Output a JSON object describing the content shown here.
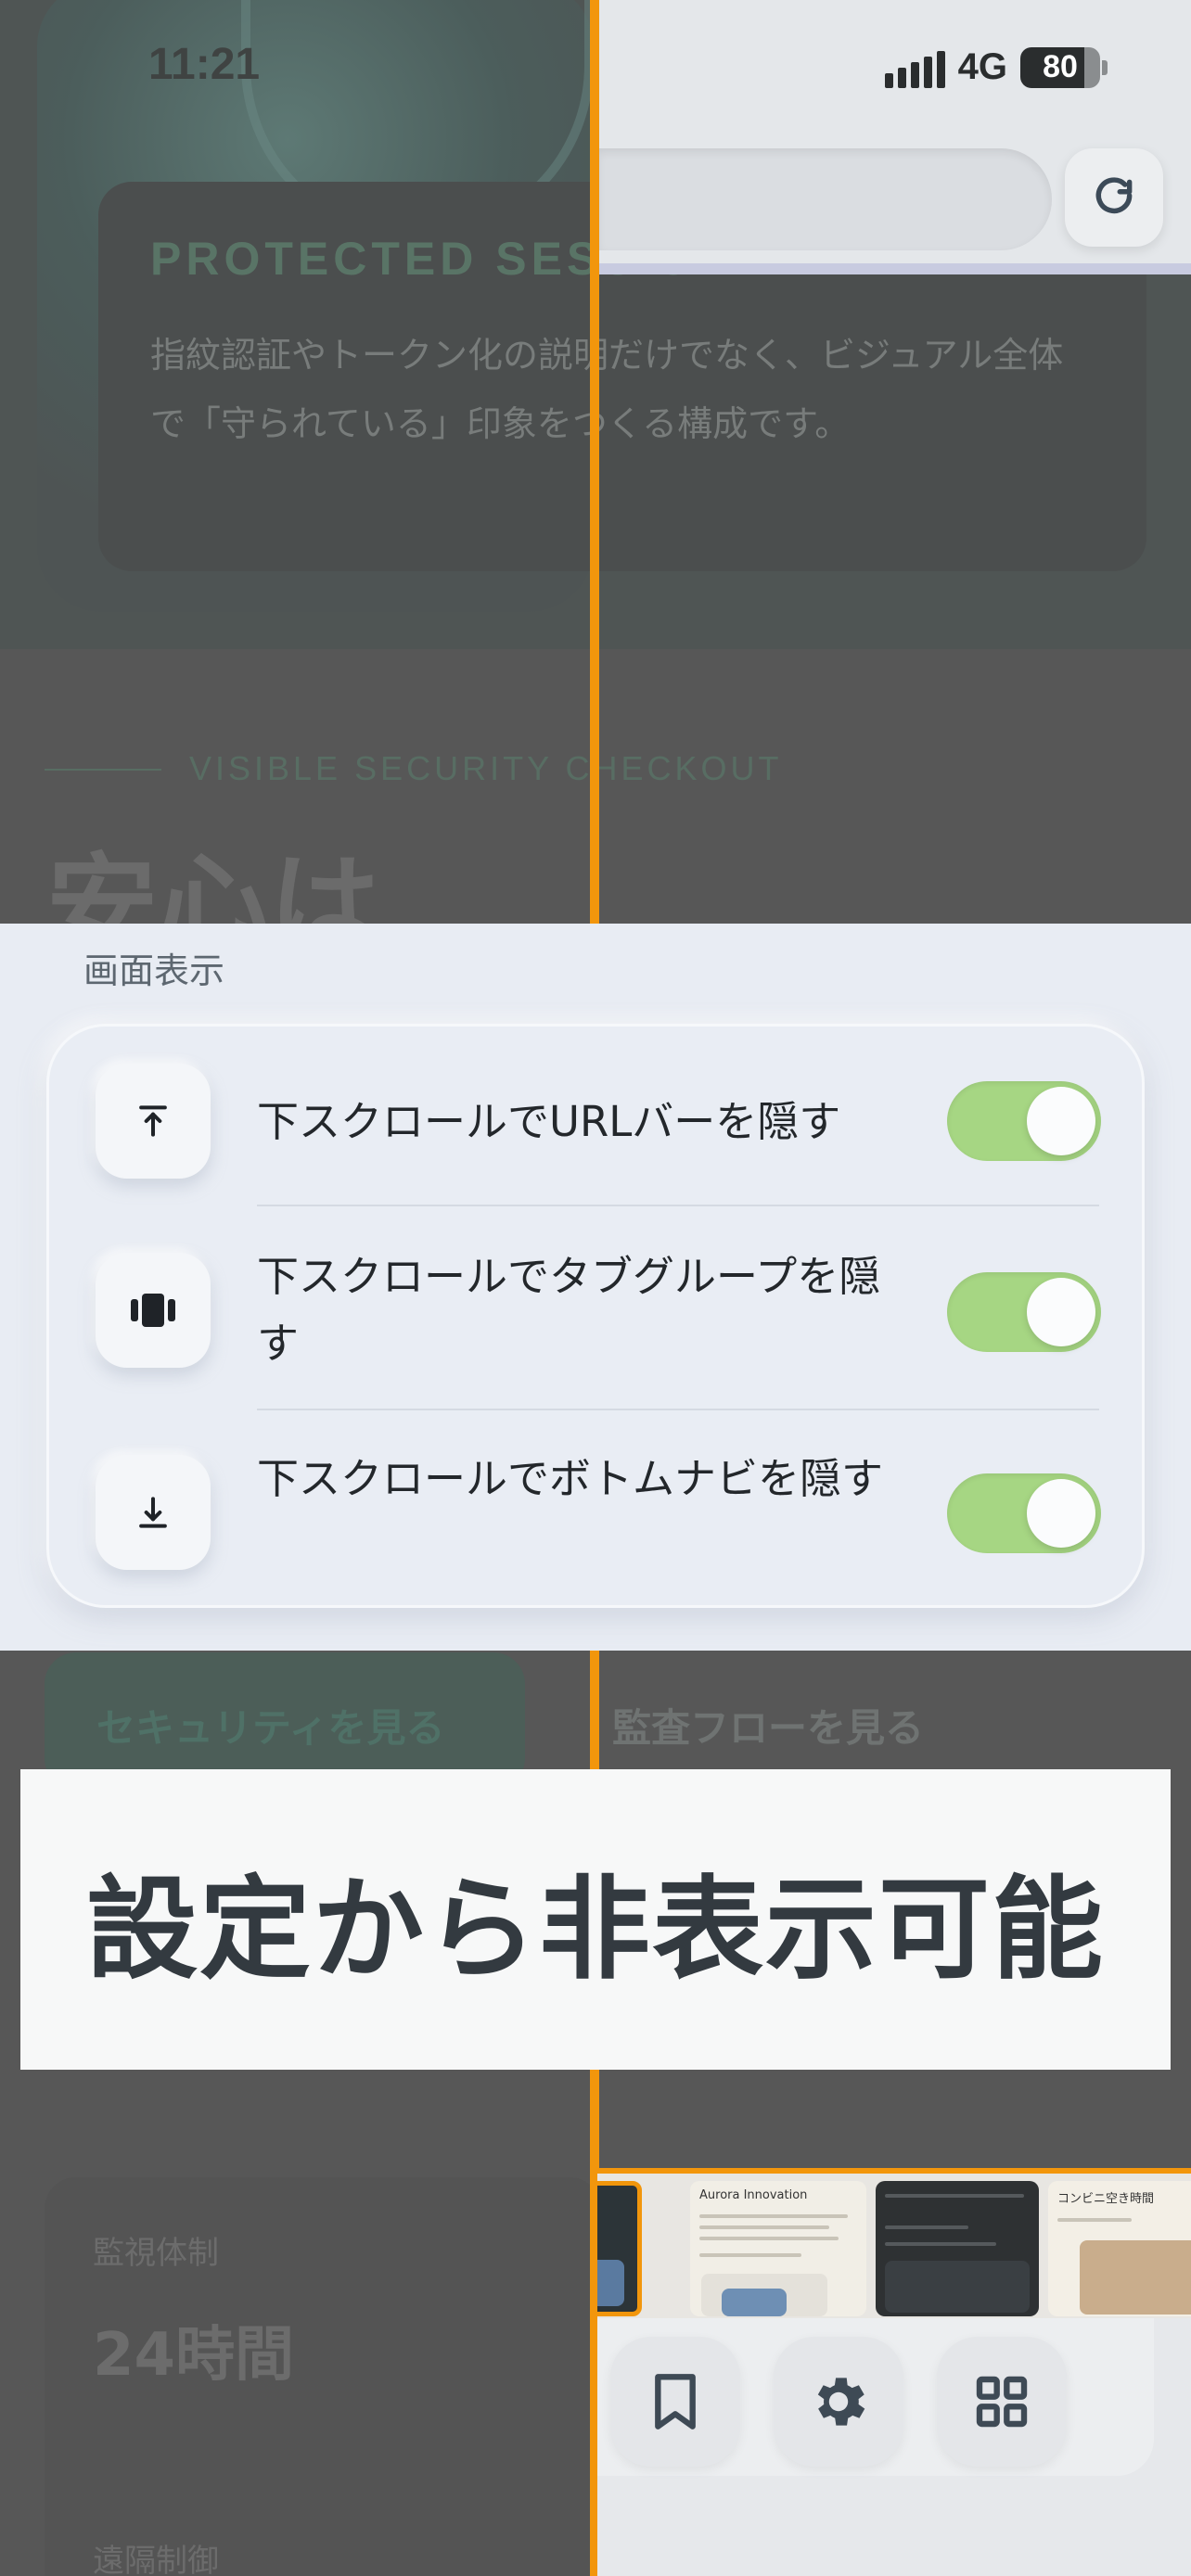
{
  "status_bar": {
    "time": "11:21",
    "network": "4G",
    "battery": "80"
  },
  "background_page": {
    "card_title": "PROTECTED SESSION",
    "card_text": "指紋認証やトークン化の説明だけでなく、ビジュアル全体で「守られている」印象をつくる構成です。",
    "eyebrow": "VISIBLE SECURITY CHECKOUT",
    "headline": "安心は",
    "primary_button": "セキュリティを見る",
    "secondary_button": "監査フローを見る",
    "stat_label": "監視体制",
    "stat_value": "24時間",
    "stat_label_2": "遠隔制御"
  },
  "settings": {
    "section_title": "画面表示",
    "items": [
      {
        "label": "下スクロールでURLバーを隠す",
        "icon": "arrow-up-to-line-icon",
        "enabled": true
      },
      {
        "label": "下スクロールでタブグループを隠す",
        "icon": "tab-group-icon",
        "enabled": true
      },
      {
        "label": "下スクロールでボトムナビを隠す",
        "icon": "arrow-down-to-line-icon",
        "enabled": true
      }
    ]
  },
  "caption": "設定から非表示可能",
  "tab_thumbnails": [
    {
      "title": ""
    },
    {
      "title": "Aurora Innovation"
    },
    {
      "title": ""
    },
    {
      "title": "コンビニ空き時間"
    }
  ],
  "bottom_nav": {
    "buttons": [
      {
        "icon": "bookmark-icon"
      },
      {
        "icon": "gear-icon"
      },
      {
        "icon": "grid-icon"
      }
    ]
  },
  "colors": {
    "accent_orange": "#f2960c",
    "toggle_on": "#a6d683",
    "sheet_bg": "#e8ecf3"
  }
}
